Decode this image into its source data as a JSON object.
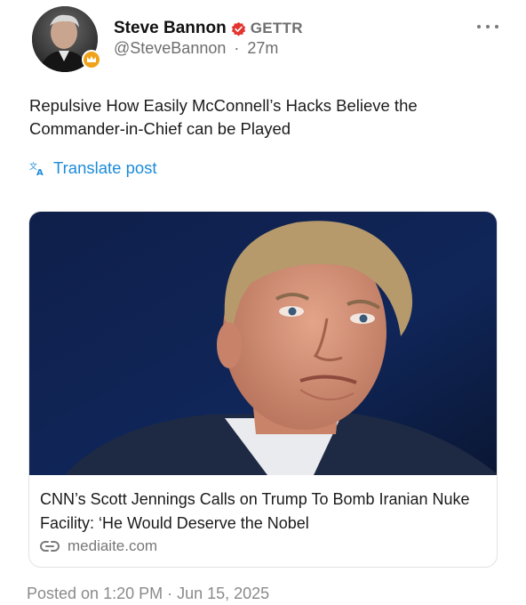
{
  "author": {
    "name": "Steve Bannon",
    "badge_text": "GETTR",
    "handle": "@SteveBannon",
    "separator": "·",
    "time_ago": "27m"
  },
  "post": {
    "text": "Repulsive How Easily McConnell’s Hacks Believe the Commander-in-Chief can be Played",
    "translate_label": "Translate post"
  },
  "link_card": {
    "title": "CNN’s Scott Jennings Calls on Trump To Bomb Iranian Nuke Facility: ‘He Would Deserve the Nobel",
    "domain": "mediaite.com"
  },
  "footer": {
    "posted_on": "Posted on 1:20 PM · Jun 15, 2025"
  },
  "icons": {
    "verified": "verified-badge-icon",
    "crown": "crown-icon",
    "translate": "translate-icon",
    "link": "link-icon",
    "more": "more-options-icon"
  },
  "colors": {
    "link_blue": "#1d8bd8",
    "verified_red": "#e3342f",
    "crown_orange": "#f0a21a",
    "secondary_text": "#6e6e6e"
  }
}
